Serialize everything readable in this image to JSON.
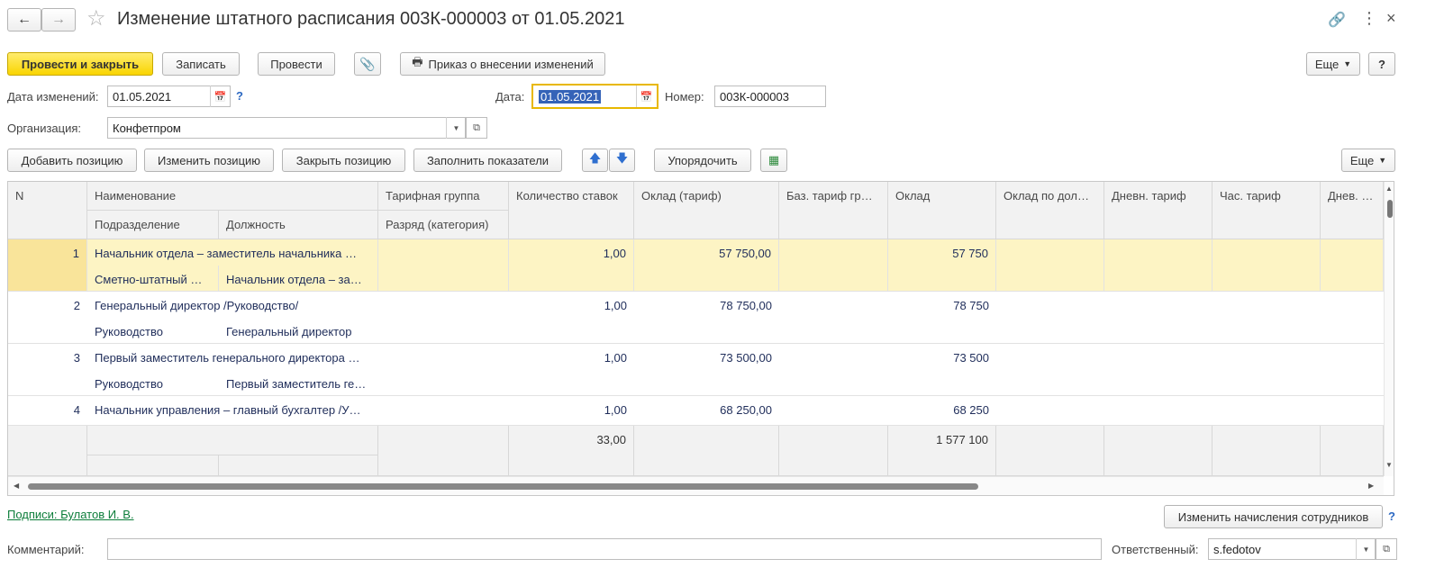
{
  "window": {
    "title": "Изменение штатного расписания 003К-000003 от 01.05.2021"
  },
  "toolbar": {
    "post_close": "Провести и закрыть",
    "save": "Записать",
    "post": "Провести",
    "order": "Приказ о внесении изменений",
    "more": "Еще",
    "help": "?"
  },
  "form": {
    "change_date_label": "Дата изменений:",
    "change_date_value": "01.05.2021",
    "date_label": "Дата:",
    "date_value": "01.05.2021",
    "number_label": "Номер:",
    "number_value": "003К-000003",
    "org_label": "Организация:",
    "org_value": "Конфетпром"
  },
  "table_toolbar": {
    "add": "Добавить позицию",
    "edit": "Изменить позицию",
    "close": "Закрыть позицию",
    "fill": "Заполнить показатели",
    "sort": "Упорядочить",
    "more": "Еще"
  },
  "table": {
    "headers": {
      "n": "N",
      "name": "Наименование",
      "division": "Подразделение",
      "position": "Должность",
      "tariff_group": "Тарифная группа",
      "grade": "Разряд (категория)",
      "rates": "Количество ставок",
      "salary_tariff": "Оклад (тариф)",
      "base_tariff": "Баз. тариф гр…",
      "salary": "Оклад",
      "salary_by": "Оклад по дол…",
      "daily": "Дневн. тариф",
      "hourly": "Час. тариф",
      "daily2": "Днев. тар"
    },
    "rows": [
      {
        "n": "1",
        "name": "Начальник отдела – заместитель начальника …",
        "division": "Сметно-штатный …",
        "position": "Начальник отдела – за…",
        "rates": "1,00",
        "salary_tariff": "57 750,00",
        "salary": "57 750"
      },
      {
        "n": "2",
        "name": "Генеральный директор /Руководство/",
        "division": "Руководство",
        "position": "Генеральный директор",
        "rates": "1,00",
        "salary_tariff": "78 750,00",
        "salary": "78 750"
      },
      {
        "n": "3",
        "name": "Первый заместитель генерального директора …",
        "division": "Руководство",
        "position": "Первый заместитель ге…",
        "rates": "1,00",
        "salary_tariff": "73 500,00",
        "salary": "73 500"
      },
      {
        "n": "4",
        "name": "Начальник управления – главный бухгалтер /У…",
        "division": "",
        "position": "",
        "rates": "1,00",
        "salary_tariff": "68 250,00",
        "salary": "68 250"
      }
    ],
    "totals": {
      "rates": "33,00",
      "salary": "1 577 100"
    }
  },
  "bottom": {
    "signatures": "Подписи: Булатов И. В.",
    "change_accruals": "Изменить начисления сотрудников",
    "help": "?",
    "comment_label": "Комментарий:",
    "comment_value": "",
    "responsible_label": "Ответственный:",
    "responsible_value": "s.fedotov"
  },
  "colors": {
    "primary_button": "#f9d500",
    "selected_row": "#fdf4c4",
    "link": "#0c7d3a",
    "help": "#2c68c2"
  }
}
